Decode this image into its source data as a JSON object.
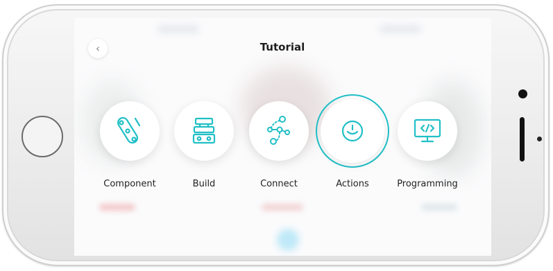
{
  "header": {
    "title": "Tutorial",
    "back_label": "‹"
  },
  "menu": {
    "selected": "Actions",
    "items": [
      {
        "label": "Component",
        "icon": "component-icon"
      },
      {
        "label": "Build",
        "icon": "build-icon"
      },
      {
        "label": "Connect",
        "icon": "connect-icon"
      },
      {
        "label": "Actions",
        "icon": "actions-icon"
      },
      {
        "label": "Programming",
        "icon": "programming-icon"
      }
    ]
  },
  "colors": {
    "accent": "#20bfc6",
    "label": "#222222",
    "title": "#1e1e1e",
    "phone_body": "#ececec"
  }
}
